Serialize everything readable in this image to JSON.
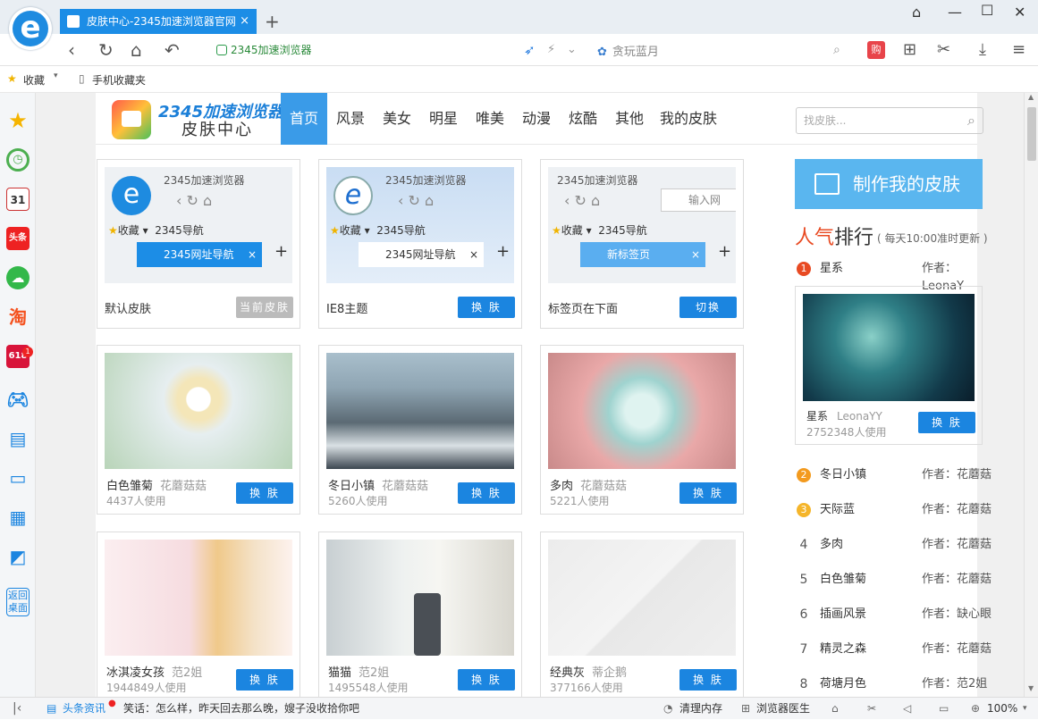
{
  "window": {
    "tab_title": "皮肤中心-2345加速浏览器官网",
    "close_tab": "×",
    "new_tab": "+"
  },
  "toolbar": {
    "address": "2345加速浏览器",
    "search_placeholder": "贪玩蓝月",
    "purchase_label": "购"
  },
  "favbar": {
    "favorites": "收藏",
    "mobile_favorites": "手机收藏夹"
  },
  "sidebar": {
    "calendar_day": "31",
    "toutiao": "头条",
    "taobao": "淘",
    "shop618": "618",
    "badge": "1",
    "back_desktop": "返回桌面"
  },
  "header": {
    "brand_top": "2345加速浏览器",
    "brand_bottom": "皮肤中心",
    "search_placeholder": "找皮肤..."
  },
  "menu": [
    "首页",
    "风景",
    "美女",
    "明星",
    "唯美",
    "动漫",
    "炫酷",
    "其他",
    "我的皮肤"
  ],
  "theme_cards": [
    {
      "name": "默认皮肤",
      "button": "当前皮肤",
      "mini_title": "2345加速浏览器",
      "mini_fav": "收藏",
      "mini_nav": "2345导航",
      "mini_tab": "2345网址导航"
    },
    {
      "name": "IE8主题",
      "button": "换 肤",
      "mini_title": "2345加速浏览器",
      "mini_fav": "收藏",
      "mini_nav": "2345导航",
      "mini_tab": "2345网址导航"
    },
    {
      "name": "标签页在下面",
      "button": "切换",
      "mini_title": "2345加速浏览器",
      "mini_fav": "收藏",
      "mini_nav": "2345导航",
      "mini_tab": "新标签页",
      "mini_input": "输入网"
    }
  ],
  "skin_cards": [
    {
      "name": "白色雏菊",
      "author": "花蘑菇菇",
      "users": "4437人使用",
      "button": "换 肤"
    },
    {
      "name": "冬日小镇",
      "author": "花蘑菇菇",
      "users": "5260人使用",
      "button": "换 肤"
    },
    {
      "name": "多肉",
      "author": "花蘑菇菇",
      "users": "5221人使用",
      "button": "换 肤"
    },
    {
      "name": "冰淇凌女孩",
      "author": "范2姐",
      "users": "1944849人使用",
      "button": "换 肤"
    },
    {
      "name": "猫猫",
      "author": "范2姐",
      "users": "1495548人使用",
      "button": "换 肤"
    },
    {
      "name": "经典灰",
      "author": "蒂企鹅",
      "users": "377166人使用",
      "button": "换 肤"
    }
  ],
  "right": {
    "make_skin": "制作我的皮肤",
    "rank_title_red": "人气",
    "rank_title_rest": "排行",
    "rank_sub": "( 每天10:00准时更新 )",
    "featured": {
      "name": "星系",
      "author": "LeonaYY",
      "users": "2752348人使用",
      "button": "换 肤"
    },
    "ranking": [
      {
        "num": "1",
        "name": "星系",
        "author": "作者：LeonaY"
      },
      {
        "num": "2",
        "name": "冬日小镇",
        "author": "作者：花蘑菇"
      },
      {
        "num": "3",
        "name": "天际蓝",
        "author": "作者：花蘑菇"
      },
      {
        "num": "4",
        "name": "多肉",
        "author": "作者：花蘑菇"
      },
      {
        "num": "5",
        "name": "白色雏菊",
        "author": "作者：花蘑菇"
      },
      {
        "num": "6",
        "name": "插画风景",
        "author": "作者：缺心眼"
      },
      {
        "num": "7",
        "name": "精灵之森",
        "author": "作者：花蘑菇"
      },
      {
        "num": "8",
        "name": "荷塘月色",
        "author": "作者：范2姐"
      }
    ]
  },
  "statusbar": {
    "news_label": "头条资讯",
    "news_text": "笑话：怎么样，昨天回去那么晚，嫂子没收拾你吧",
    "clean_memory": "清理内存",
    "browser_doctor": "浏览器医生",
    "zoom": "100%"
  },
  "colors": {
    "accent": "#1b85e0",
    "rank_red": "#e84a22",
    "rank_orange": "#f39a1e"
  }
}
